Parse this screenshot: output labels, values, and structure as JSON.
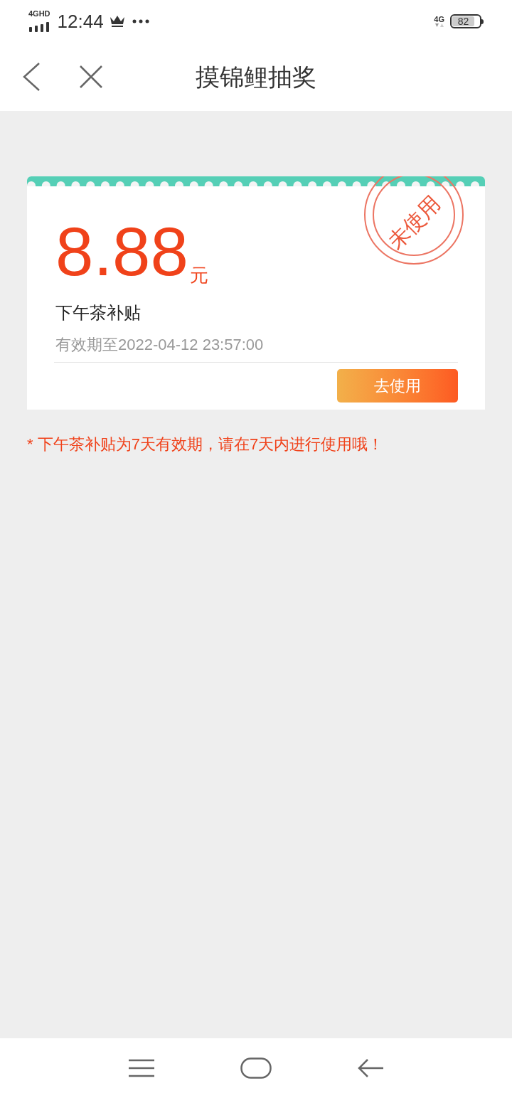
{
  "status_bar": {
    "network": "4GHD",
    "time": "12:44",
    "data_network": "4G",
    "battery": "82"
  },
  "header": {
    "title": "摸锦鲤抽奖"
  },
  "coupon": {
    "amount": "8.88",
    "unit": "元",
    "name": "下午茶补贴",
    "validity": "有效期至2022-04-12 23:57:00",
    "stamp": "未使用",
    "button": "去使用"
  },
  "note": "* 下午茶补贴为7天有效期，请在7天内进行使用哦！"
}
